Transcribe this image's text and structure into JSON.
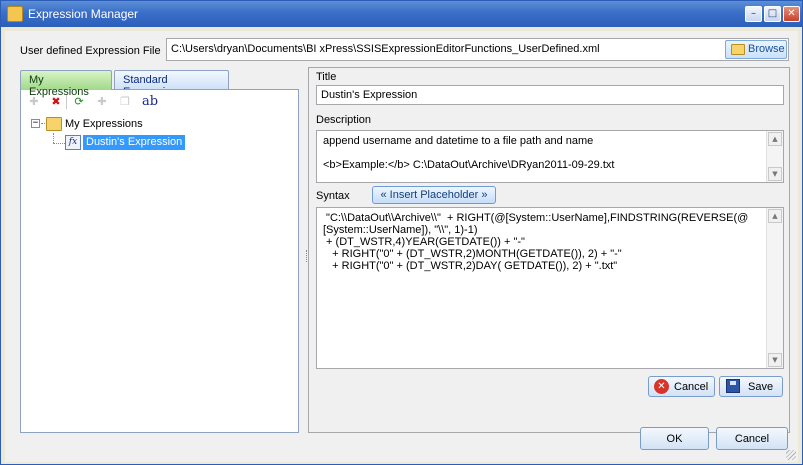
{
  "window": {
    "title": "Expression Manager",
    "minimize": "–",
    "maximize": "□",
    "close": "✕"
  },
  "file": {
    "label": "User defined Expression File",
    "path": "C:\\Users\\dryan\\Documents\\BI xPress\\SSISExpressionEditorFunctions_UserDefined.xml",
    "browse_label": "Browse"
  },
  "tabs": [
    {
      "label": "My Expressions",
      "active": true
    },
    {
      "label": "Standard Expression",
      "active": false
    }
  ],
  "toolbar": {
    "new": "✚",
    "delete": "✖",
    "refresh": "⟳",
    "add": "✚",
    "copy": "❐",
    "rename": "ab"
  },
  "tree": {
    "toggle": "−",
    "root_label": "My Expressions",
    "child_icon": "fx",
    "child_label": "Dustin's Expression"
  },
  "editor": {
    "title_label": "Title",
    "title_value": "Dustin's Expression",
    "description_label": "Description",
    "description_lines": [
      "append username and datetime to a file path and name",
      "",
      "<b>Example:</b> C:\\DataOut\\Archive\\DRyan2011-09-29.txt"
    ],
    "syntax_label": "Syntax",
    "placeholder_button": "« Insert Placeholder »",
    "syntax_lines": [
      " \"C:\\\\DataOut\\\\Archive\\\\\"  + RIGHT(@[System::UserName],FINDSTRING(REVERSE(@",
      "[System::UserName]), \"\\\\\", 1)-1)",
      " + (DT_WSTR,4)YEAR(GETDATE()) + \"-\"",
      "   + RIGHT(\"0\" + (DT_WSTR,2)MONTH(GETDATE()), 2) + \"-\"",
      "   + RIGHT(\"0\" + (DT_WSTR,2)DAY( GETDATE()), 2) + \".txt\""
    ],
    "cancel_label": "Cancel",
    "save_label": "Save",
    "scroll_up": "▲",
    "scroll_down": "▼"
  },
  "dialog": {
    "ok_label": "OK",
    "cancel_label": "Cancel"
  },
  "icons": {
    "cancel_glyph": "✕"
  },
  "colors": {
    "title_bar": "#2c5fb9",
    "selection": "#3399ff",
    "active_tab": "#9fd98a"
  }
}
